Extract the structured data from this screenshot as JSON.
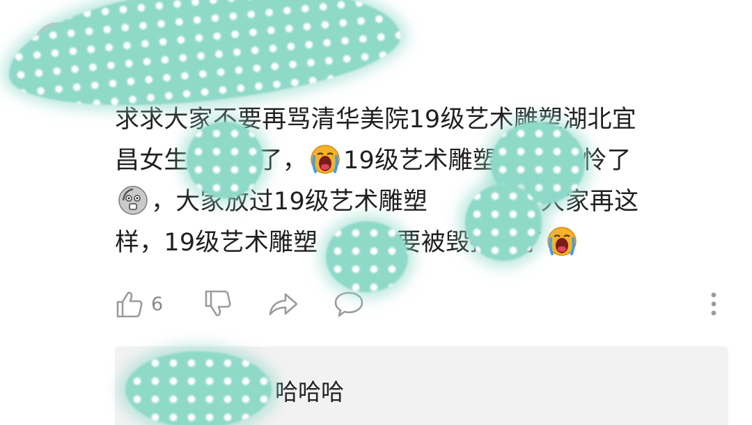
{
  "comment": {
    "line1": "求求大家不要再骂清华美院19级艺术雕塑湖北宜",
    "line2a": "昌女生",
    "line2b": "了，",
    "line2c": "19级艺术雕塑",
    "line2d": "太可怜了",
    "line3a": "，大家放过19级艺术雕塑",
    "line3b": "吧，大家再这",
    "line4a": "样，19级艺术雕塑",
    "line4b": "就要被毁掉了了",
    "emojis": [
      "crying-face-emoji",
      "scared-face-emoji",
      "crying-face-emoji"
    ]
  },
  "actions": {
    "like_count": "6",
    "icons": [
      "thumbs-up-icon",
      "thumbs-down-icon",
      "share-icon",
      "comment-icon",
      "more-vertical-icon"
    ]
  },
  "reply": {
    "text": "哈哈哈"
  },
  "colors": {
    "redaction": "#8fd9c9",
    "text": "#1f1f1f",
    "icon": "#9a9a9a",
    "reply_bg": "#f2f2f2"
  }
}
